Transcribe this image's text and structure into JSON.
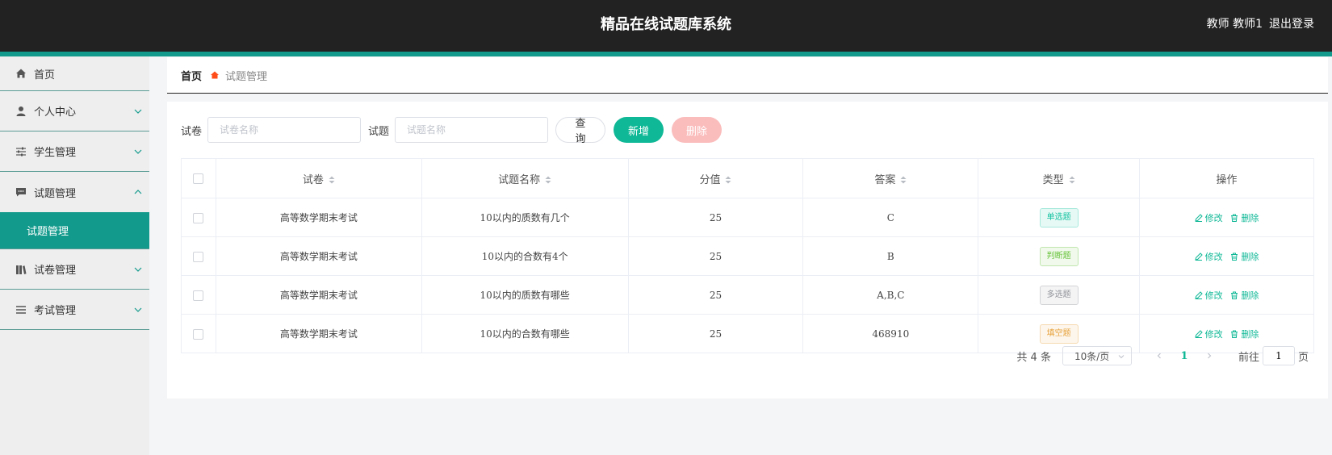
{
  "header": {
    "title": "精品在线试题库系统",
    "user": "教师 教师1",
    "logout": "退出登录"
  },
  "sidebar": {
    "items": [
      {
        "label": "首页",
        "icon": "home-icon"
      },
      {
        "label": "个人中心",
        "icon": "user-icon"
      },
      {
        "label": "学生管理",
        "icon": "sliders-icon"
      },
      {
        "label": "试题管理",
        "icon": "chat-icon"
      },
      {
        "label": "试卷管理",
        "icon": "books-icon"
      },
      {
        "label": "考试管理",
        "icon": "list-icon"
      }
    ],
    "active_sub": "试题管理"
  },
  "breadcrumb": {
    "home": "首页",
    "current": "试题管理"
  },
  "search": {
    "paper_label": "试卷",
    "paper_placeholder": "试卷名称",
    "question_label": "试题",
    "question_placeholder": "试题名称",
    "query": "查询",
    "add": "新增",
    "delete": "删除"
  },
  "table": {
    "headers": [
      "试卷",
      "试题名称",
      "分值",
      "答案",
      "类型",
      "操作"
    ],
    "rows": [
      {
        "paper": "高等数学期末考试",
        "question": "10以内的质数有几个",
        "score": "25",
        "answer": "C",
        "type": "单选题"
      },
      {
        "paper": "高等数学期末考试",
        "question": "10以内的合数有4个",
        "score": "25",
        "answer": "B",
        "type": "判断题"
      },
      {
        "paper": "高等数学期末考试",
        "question": "10以内的质数有哪些",
        "score": "25",
        "answer": "A,B,C",
        "type": "多选题"
      },
      {
        "paper": "高等数学期末考试",
        "question": "10以内的合数有哪些",
        "score": "25",
        "answer": "468910",
        "type": "填空题"
      }
    ],
    "edit": "修改",
    "delete": "删除"
  },
  "pagination": {
    "total": "共 4 条",
    "page_size": "10条/页",
    "current_page": "1",
    "goto_label": "前往",
    "goto_value": "1",
    "page_suffix": "页"
  },
  "colors": {
    "accent": "#129a8c",
    "primary_button": "#0fb896",
    "danger_disabled": "#fbbcbc"
  }
}
